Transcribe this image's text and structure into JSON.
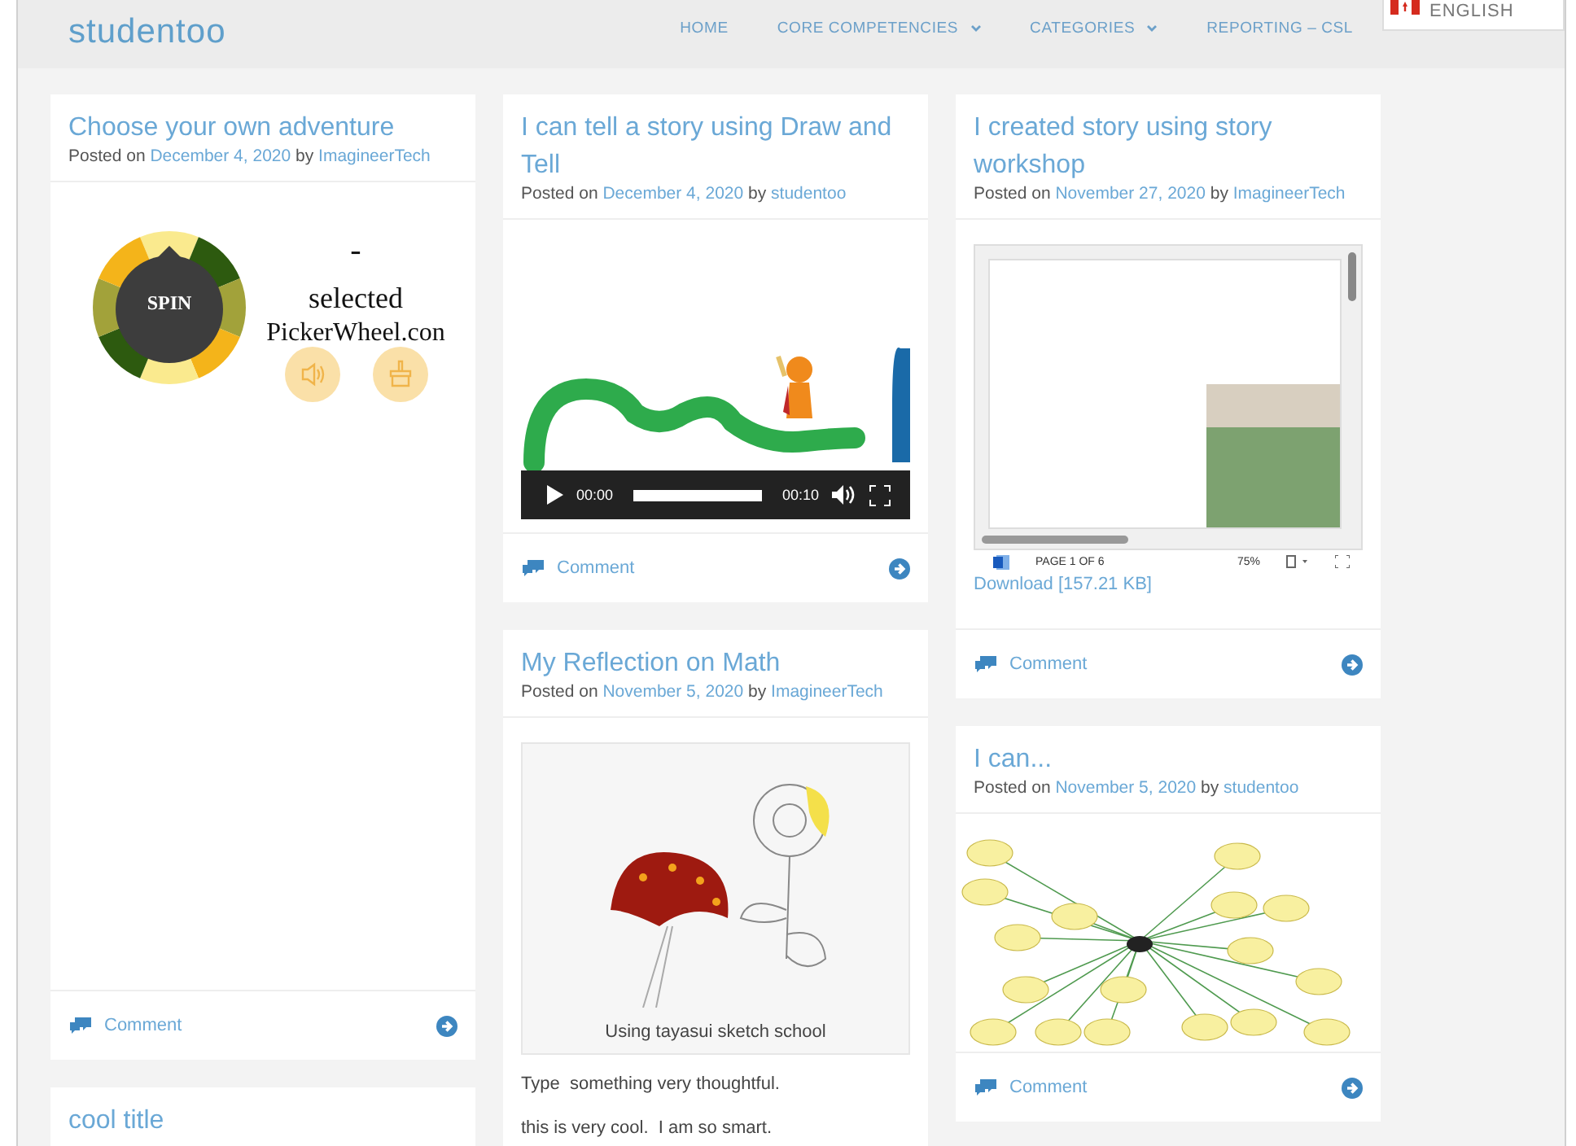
{
  "site": {
    "title": "studentoo"
  },
  "nav": [
    {
      "label": "HOME",
      "dropdown": false
    },
    {
      "label": "CORE COMPETENCIES",
      "dropdown": true
    },
    {
      "label": "CATEGORIES",
      "dropdown": true
    },
    {
      "label": "REPORTING – CSL",
      "dropdown": false
    }
  ],
  "language": {
    "label": "ENGLISH"
  },
  "columns": [
    [
      {
        "kind": "wheel",
        "title": "Choose your own adventure",
        "posted_on": "Posted on",
        "date": "December 4, 2020",
        "by": "by",
        "author": "ImagineerTech",
        "wheel": {
          "button": "SPIN",
          "result": "-",
          "status": "selected",
          "brand": "PickerWheel.con"
        },
        "comment": "Comment"
      },
      {
        "kind": "title_only",
        "title": "cool title"
      }
    ],
    [
      {
        "kind": "video",
        "title": "I can tell a story using Draw and Tell",
        "posted_on": "Posted on",
        "date": "December 4, 2020",
        "by": "by",
        "author": "studentoo",
        "video": {
          "current": "00:00",
          "duration": "00:10"
        },
        "comment": "Comment"
      },
      {
        "kind": "image",
        "title": "My Reflection on Math",
        "posted_on": "Posted on",
        "date": "November 5, 2020",
        "by": "by",
        "author": "ImagineerTech",
        "caption": "Using tayasui sketch school",
        "paragraphs": [
          "Type  something very thoughtful.",
          "this is very cool.  I am so smart."
        ]
      }
    ],
    [
      {
        "kind": "document",
        "title": "I created story using story workshop",
        "posted_on": "Posted on",
        "date": "November 27, 2020",
        "by": "by",
        "author": "ImagineerTech",
        "document": {
          "page": "PAGE 1 OF 6",
          "zoom": "75%",
          "download": "Download [157.21 KB]"
        },
        "comment": "Comment"
      },
      {
        "kind": "map",
        "title": "I can...",
        "posted_on": "Posted on",
        "date": "November 5, 2020",
        "by": "by",
        "author": "studentoo",
        "comment": "Comment"
      }
    ]
  ]
}
